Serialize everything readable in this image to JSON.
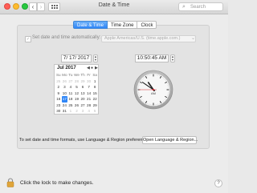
{
  "window": {
    "title": "Date & Time",
    "nav_back": "‹",
    "nav_forward": "›",
    "search_placeholder": "Search"
  },
  "tabs": [
    {
      "label": "Date & Time",
      "active": true
    },
    {
      "label": "Time Zone",
      "active": false
    },
    {
      "label": "Clock",
      "active": false
    }
  ],
  "auto": {
    "label": "Set date and time automatically:",
    "checked": true,
    "server": "Apple Americas/U.S. (time.apple.com.)"
  },
  "date": {
    "field_value": "7/ 17/ 2017",
    "month_label": "Jul 2017",
    "weekdays": [
      "Su",
      "Mo",
      "Tu",
      "We",
      "Th",
      "Fr",
      "Sa"
    ],
    "weeks": [
      [
        "25",
        "26",
        "27",
        "28",
        "29",
        "30",
        "1"
      ],
      [
        "2",
        "3",
        "4",
        "5",
        "6",
        "7",
        "8"
      ],
      [
        "9",
        "10",
        "11",
        "12",
        "13",
        "14",
        "15"
      ],
      [
        "16",
        "17",
        "18",
        "19",
        "20",
        "21",
        "22"
      ],
      [
        "23",
        "24",
        "25",
        "26",
        "27",
        "28",
        "29"
      ],
      [
        "30",
        "31",
        "1",
        "2",
        "3",
        "4",
        "5"
      ]
    ],
    "selected_day": "17"
  },
  "time": {
    "field_value": "10:50:45 AM",
    "clock_label": "AM",
    "hour": 10,
    "minute": 50,
    "second": 45
  },
  "footer": {
    "text": "To set date and time formats, use Language & Region preferences.",
    "button": "Open Language & Region..."
  },
  "lock": {
    "text": "Click the lock to make changes."
  },
  "help": "?",
  "colors": {
    "accent": "#2f86f7",
    "second_hand": "#d0262d"
  }
}
